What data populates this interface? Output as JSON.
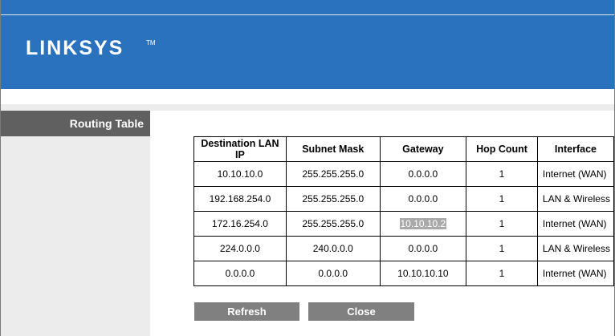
{
  "brand": {
    "logo": "LINKSYS",
    "trademark": "TM"
  },
  "sidebar": {
    "items": [
      {
        "label": "Routing Table"
      }
    ]
  },
  "table": {
    "headers": [
      "Destination LAN IP",
      "Subnet Mask",
      "Gateway",
      "Hop Count",
      "Interface"
    ],
    "rows": [
      {
        "dest": "10.10.10.0",
        "mask": "255.255.255.0",
        "gateway": "0.0.0.0",
        "hop": "1",
        "iface": "Internet (WAN)"
      },
      {
        "dest": "192.168.254.0",
        "mask": "255.255.255.0",
        "gateway": "0.0.0.0",
        "hop": "1",
        "iface": "LAN & Wireless"
      },
      {
        "dest": "172.16.254.0",
        "mask": "255.255.255.0",
        "gateway": "10.10.10.2",
        "hop": "1",
        "iface": "Internet (WAN)"
      },
      {
        "dest": "224.0.0.0",
        "mask": "240.0.0.0",
        "gateway": "0.0.0.0",
        "hop": "1",
        "iface": "LAN & Wireless"
      },
      {
        "dest": "0.0.0.0",
        "mask": "0.0.0.0",
        "gateway": "10.10.10.10",
        "hop": "1",
        "iface": "Internet (WAN)"
      }
    ]
  },
  "buttons": {
    "refresh": "Refresh",
    "close": "Close"
  },
  "colors": {
    "header_blue": "#2a71be",
    "sidebar_active": "#606060",
    "button_gray": "#808080",
    "selection_gray": "#a9a9a9"
  }
}
